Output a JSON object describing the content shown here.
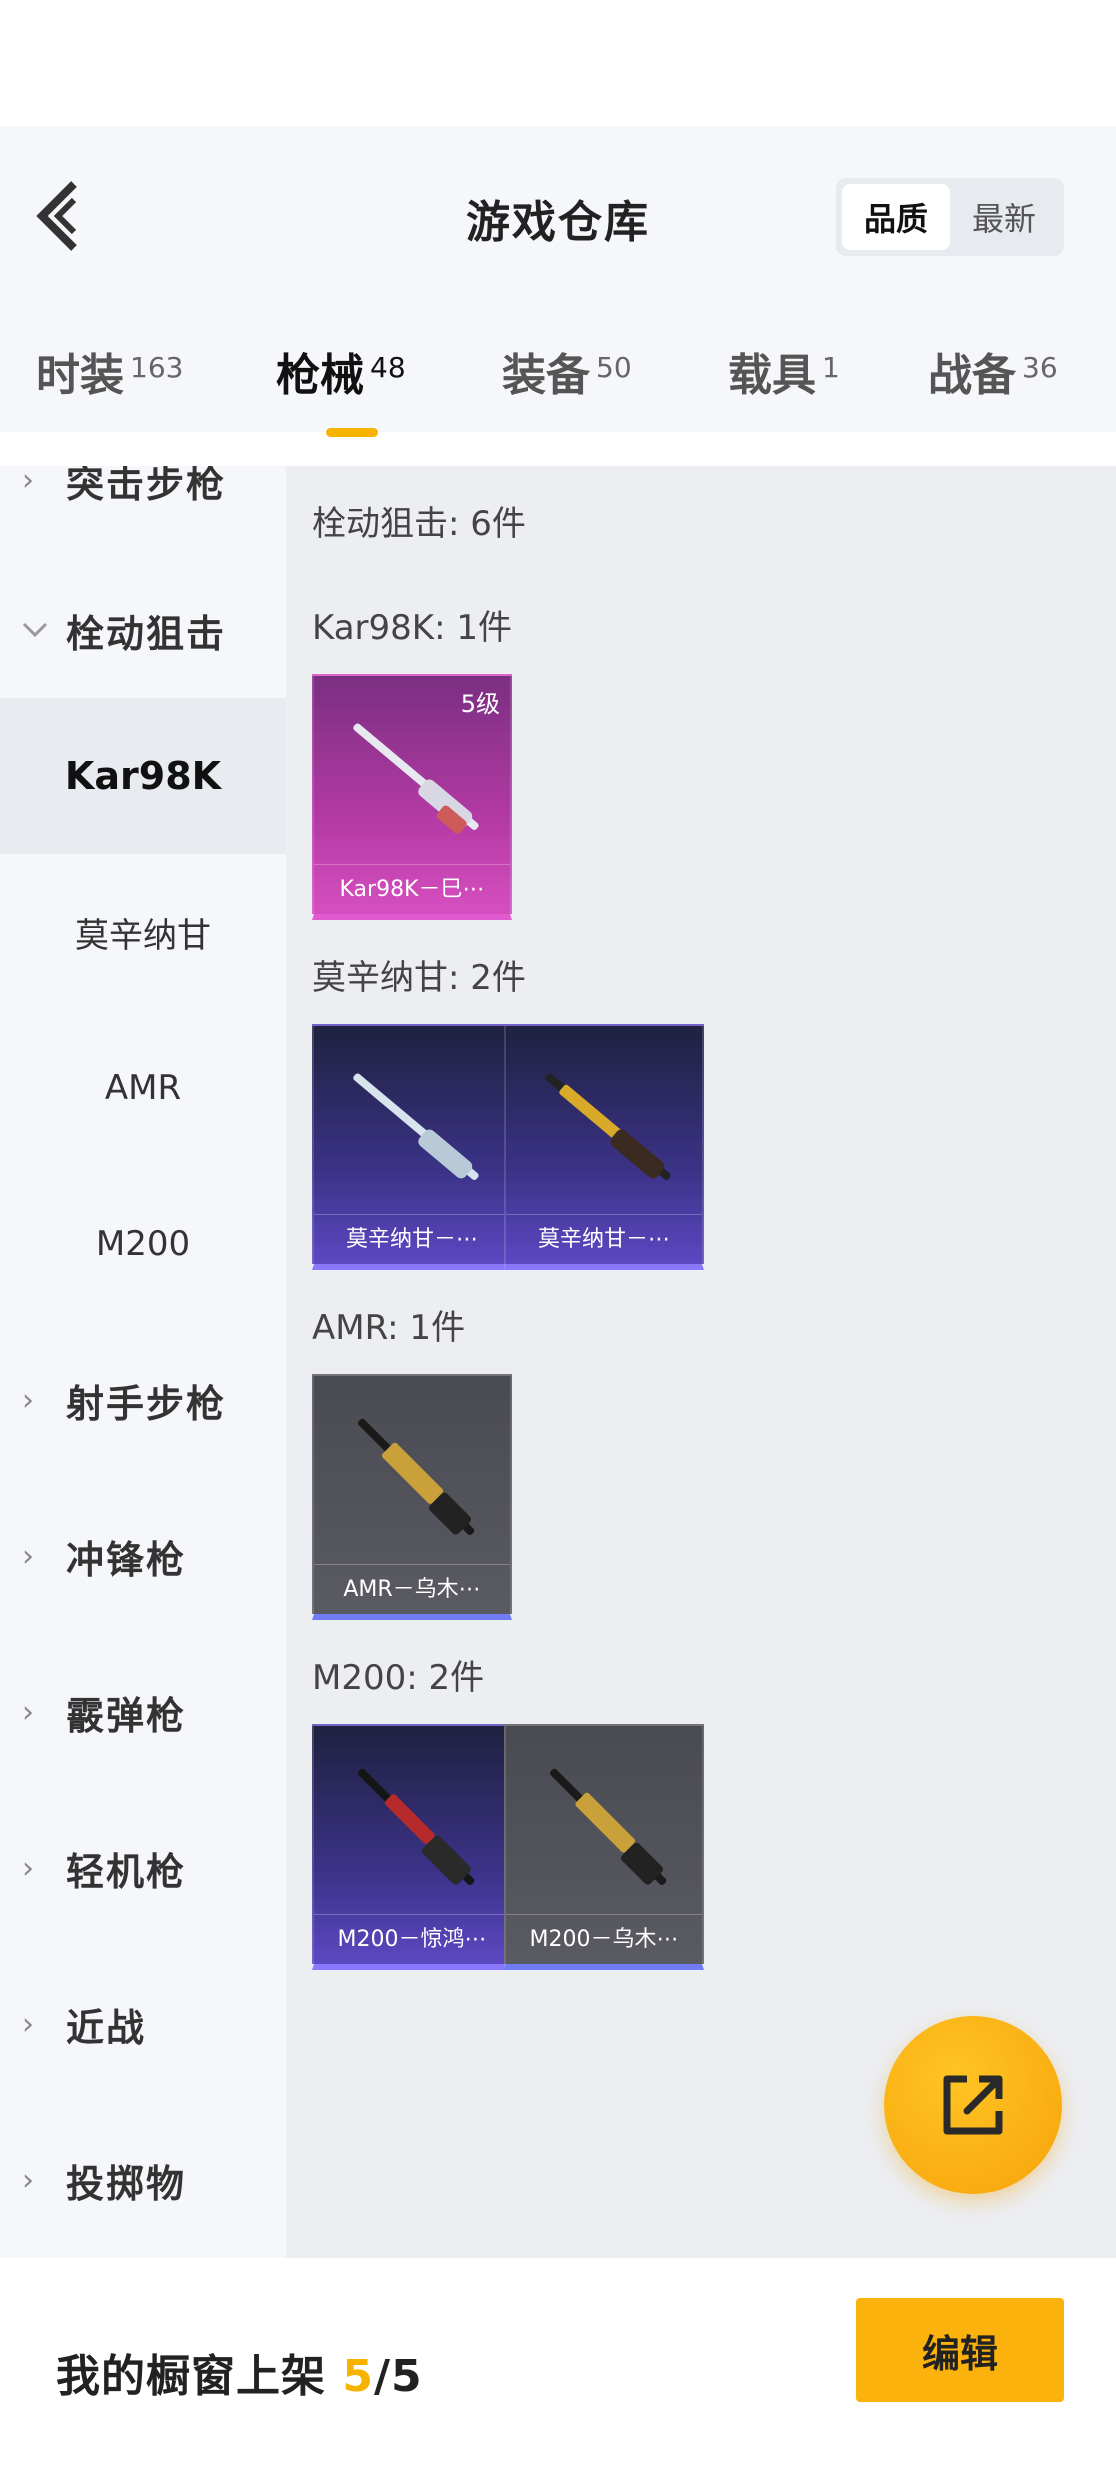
{
  "header": {
    "title": "游戏仓库",
    "sort_options": [
      {
        "label": "品质",
        "active": true
      },
      {
        "label": "最新",
        "active": false
      }
    ]
  },
  "tabs": [
    {
      "label": "时装",
      "count": "163",
      "active": false
    },
    {
      "label": "枪械",
      "count": "48",
      "active": true
    },
    {
      "label": "装备",
      "count": "50",
      "active": false
    },
    {
      "label": "载具",
      "count": "1",
      "active": false
    },
    {
      "label": "战备",
      "count": "36",
      "active": false
    }
  ],
  "sidebar": {
    "partial_top": "突击步枪",
    "expanded_category": "栓动狙击",
    "sub_items": [
      "Kar98K",
      "莫辛纳甘",
      "AMR",
      "M200"
    ],
    "active_sub": "Kar98K",
    "categories": [
      "射手步枪",
      "冲锋枪",
      "霰弹枪",
      "轻机枪",
      "近战",
      "投掷物"
    ]
  },
  "content": {
    "summary": "栓动狙击: 6件",
    "groups": [
      {
        "title": "Kar98K: 1件",
        "items": [
          {
            "name": "Kar98K－巳⋯",
            "level": "5级",
            "rarity": "pink"
          }
        ]
      },
      {
        "title": "莫辛纳甘: 2件",
        "items": [
          {
            "name": "莫辛纳甘－⋯",
            "rarity": "purple"
          },
          {
            "name": "莫辛纳甘－⋯",
            "rarity": "purple"
          }
        ]
      },
      {
        "title": "AMR: 1件",
        "items": [
          {
            "name": "AMR－乌木⋯",
            "rarity": "gray"
          }
        ]
      },
      {
        "title": "M200: 2件",
        "items": [
          {
            "name": "M200－惊鸿⋯",
            "rarity": "purple"
          },
          {
            "name": "M200－乌木⋯",
            "rarity": "gray"
          }
        ]
      }
    ]
  },
  "bottom_bar": {
    "shelf_label": "我的橱窗上架",
    "shelf_count": "5",
    "shelf_total": "/5",
    "edit_label": "编辑"
  },
  "colors": {
    "accent": "#f7b300",
    "rarity_pink": "#d64fc0",
    "rarity_purple": "#5c48c2",
    "rarity_gray": "#5a5a62"
  },
  "icons": {
    "back": "chevron-left-icon",
    "fab": "share-external-icon",
    "chevron": "chevron-right-icon",
    "expand": "chevron-down-icon"
  }
}
